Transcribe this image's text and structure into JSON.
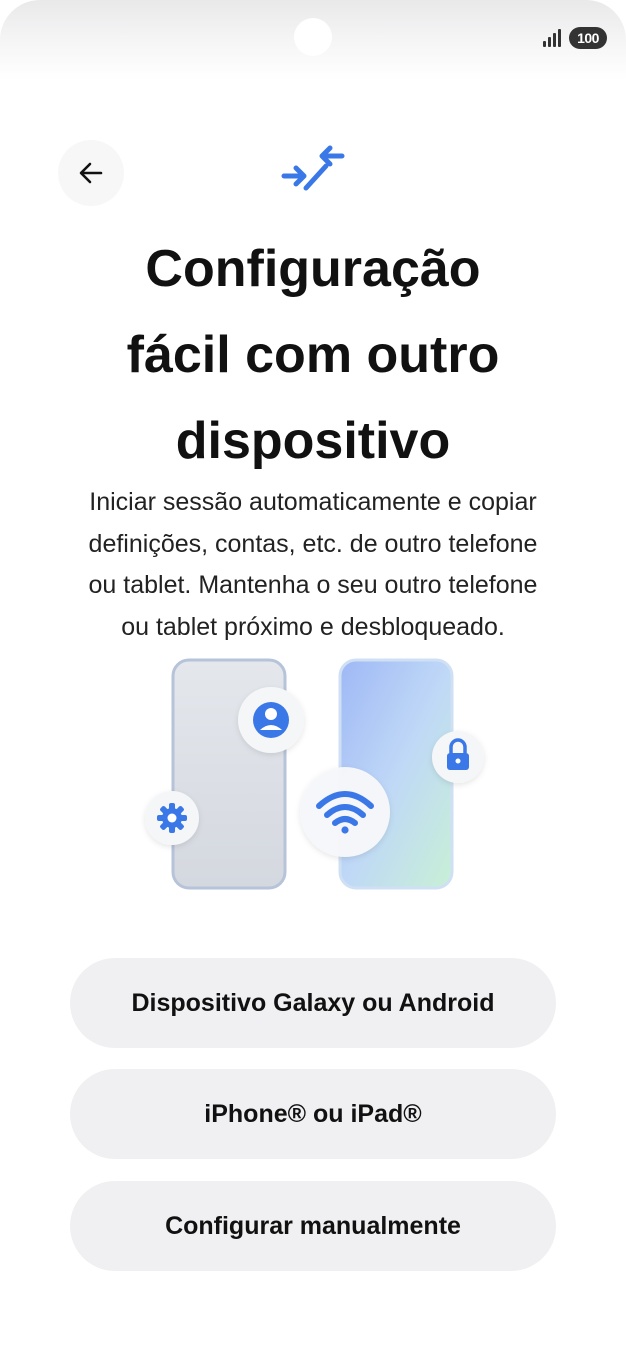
{
  "status_bar": {
    "battery_level": "100"
  },
  "header": {
    "back_icon": "arrow-left-icon",
    "transfer_icon": "transfer-arrows-icon"
  },
  "title_lines": [
    "Configuração",
    "fácil com outro",
    "dispositivo"
  ],
  "description_lines": [
    "Iniciar sessão automaticamente e copiar",
    "definições, contas, etc. de outro telefone",
    "ou tablet. Mantenha o seu outro telefone",
    "ou tablet próximo e desbloqueado."
  ],
  "illustration": {
    "icons": [
      "person-icon",
      "gear-icon",
      "wifi-icon",
      "lock-icon"
    ]
  },
  "options": [
    {
      "label": "Dispositivo Galaxy ou Android"
    },
    {
      "label": "iPhone® ou iPad®"
    },
    {
      "label": "Configurar manualmente"
    }
  ],
  "colors": {
    "accent": "#3b78e7",
    "button_bg": "#f0f0f2"
  }
}
